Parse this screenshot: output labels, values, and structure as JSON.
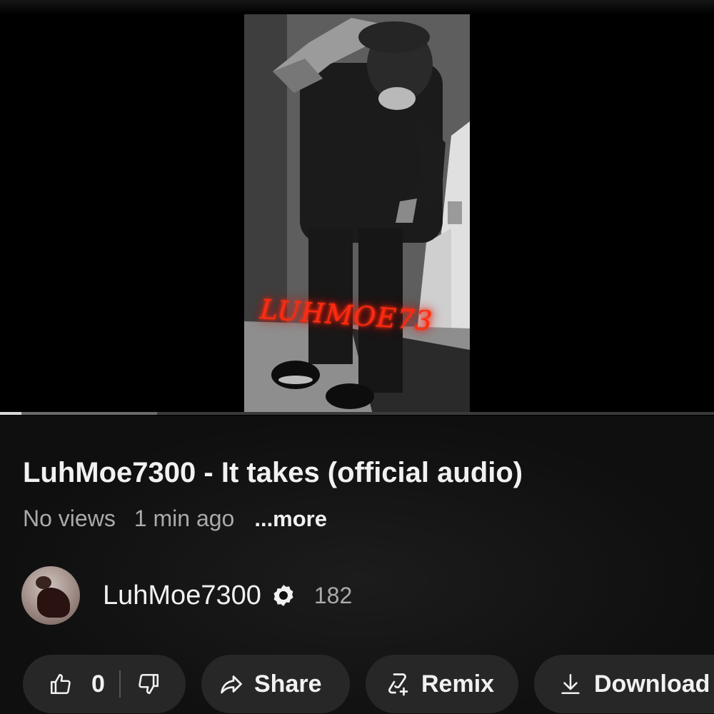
{
  "video": {
    "watermark": "LUHMOE73",
    "progress_fraction": 0.03,
    "buffered_fraction": 0.22
  },
  "title": "LuhMoe7300 - It takes (official audio)",
  "meta": {
    "views": "No views",
    "age": "1 min ago",
    "more": "...more"
  },
  "channel": {
    "name": "LuhMoe7300",
    "subscribers": "182",
    "verified_icon": "verified-badge-icon"
  },
  "actions": {
    "likes": "0",
    "like_icon": "thumbs-up-icon",
    "dislike_icon": "thumbs-down-icon",
    "share_label": "Share",
    "share_icon": "share-arrow-icon",
    "remix_label": "Remix",
    "remix_icon": "remix-icon",
    "download_label": "Download",
    "download_icon": "download-icon"
  },
  "colors": {
    "background": "#0f0f0f",
    "pill": "#272727",
    "watermark": "#ff2a10",
    "secondary_text": "#aaaaaa"
  }
}
